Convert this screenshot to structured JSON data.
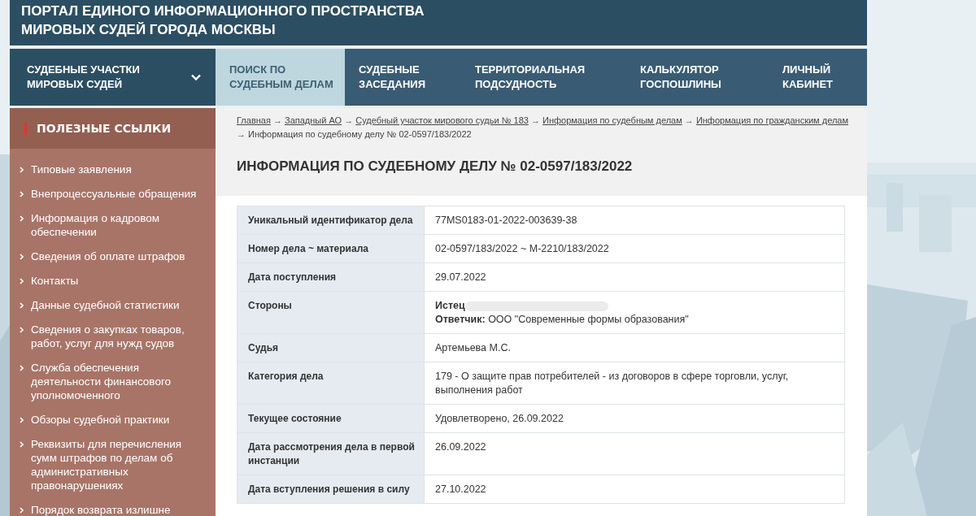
{
  "header": {
    "title": "ПОРТАЛ ЕДИНОГО ИНФОРМАЦИОННОГО ПРОСТРАНСТВА МИРОВЫХ СУДЕЙ ГОРОДА МОСКВЫ"
  },
  "nav": [
    {
      "label": "СУДЕБНЫЕ УЧАСТКИ МИРОВЫХ СУДЕЙ",
      "selected": false,
      "has_dropdown": true
    },
    {
      "label": "ПОИСК ПО СУДЕБНЫМ ДЕЛАМ",
      "selected": true,
      "has_dropdown": false
    },
    {
      "label": "СУДЕБНЫЕ ЗАСЕДАНИЯ",
      "selected": false,
      "has_dropdown": false
    },
    {
      "label": "ТЕРРИТОРИАЛЬНАЯ ПОДСУДНОСТЬ",
      "selected": false,
      "has_dropdown": false
    },
    {
      "label": "КАЛЬКУЛЯТОР ГОСПОШЛИНЫ",
      "selected": false,
      "has_dropdown": false
    },
    {
      "label": "ЛИЧНЫЙ КАБИНЕТ",
      "selected": false,
      "has_dropdown": false
    }
  ],
  "sidebar": {
    "title": "ПОЛЕЗНЫЕ ССЫЛКИ",
    "items": [
      "Типовые заявления",
      "Внепроцессуальные обращения",
      "Информация о кадровом обеспечении",
      "Сведения об оплате штрафов",
      "Контакты",
      "Данные судебной статистики",
      "Сведения о закупках товаров, работ, услуг для нужд судов",
      "Служба обеспечения деятельности финансового уполномоченного",
      "Обзоры судебной практики",
      "Реквизиты для перечисления сумм штрафов по делам об административных правонарушениях",
      "Порядок возврата излишне"
    ]
  },
  "breadcrumbs": {
    "separator": "→",
    "items": [
      {
        "label": "Главная",
        "kind": "link"
      },
      {
        "label": "Западный АО",
        "kind": "link"
      },
      {
        "label": "Судебный участок мирового судьи № 183",
        "kind": "link"
      },
      {
        "label": "Информация по судебным делам",
        "kind": "link"
      },
      {
        "label": "Информация по гражданским делам",
        "kind": "link"
      },
      {
        "label": "Информация по судебному делу № 02-0597/183/2022",
        "kind": "current"
      }
    ]
  },
  "page_title": "ИНФОРМАЦИЯ ПО СУДЕБНОМУ ДЕЛУ № 02-0597/183/2022",
  "case_table": [
    {
      "label": "Уникальный идентификатор дела",
      "kind": "text",
      "value": "77MS0183-01-2022-003639-38"
    },
    {
      "label": "Номер дела ~ материала",
      "kind": "text",
      "value": "02-0597/183/2022 ~ М-2210/183/2022"
    },
    {
      "label": "Дата поступления",
      "kind": "text",
      "value": "29.07.2022"
    },
    {
      "label": "Стороны",
      "kind": "parties",
      "parties": [
        {
          "role": "Истец",
          "redacted": true
        },
        {
          "role": "Ответчик:",
          "redacted": false,
          "name": "ООО \"Современные формы образования\""
        }
      ]
    },
    {
      "label": "Судья",
      "kind": "text",
      "value": "Артемьева М.С."
    },
    {
      "label": "Категория дела",
      "kind": "text",
      "value": "179 - О защите прав потребителей - из договоров в сфере торговли, услуг, выполнения работ"
    },
    {
      "label": "Текущее состояние",
      "kind": "text",
      "value": "Удовлетворено, 26.09.2022"
    },
    {
      "label": "Дата рассмотрения дела в первой инстанции",
      "kind": "text",
      "value": "26.09.2022"
    },
    {
      "label": "Дата вступления решения в силу",
      "kind": "text",
      "value": "27.10.2022"
    }
  ]
}
